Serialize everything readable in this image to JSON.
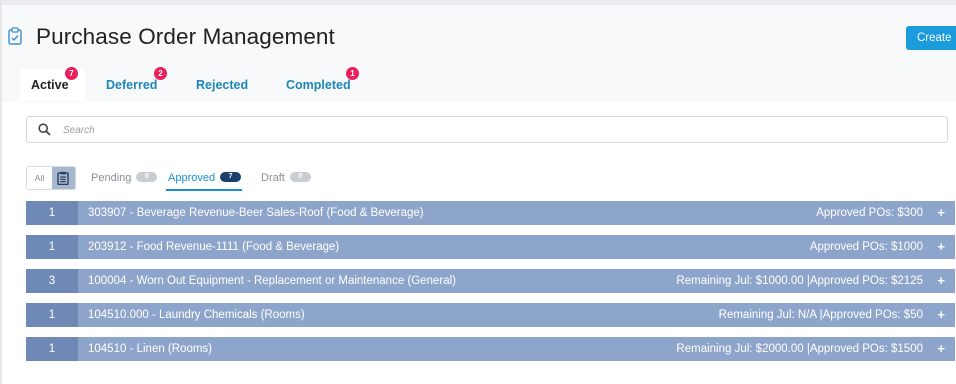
{
  "header": {
    "title": "Purchase Order Management",
    "title_icon": "clipboard-check-icon",
    "create_label": "Create"
  },
  "tabs": [
    {
      "label": "Active",
      "badge": "7",
      "active": true
    },
    {
      "label": "Deferred",
      "badge": "2",
      "active": false
    },
    {
      "label": "Rejected",
      "badge": "",
      "active": false
    },
    {
      "label": "Completed",
      "badge": "1",
      "active": false
    }
  ],
  "search": {
    "placeholder": "Search",
    "value": "",
    "icon": "search-icon"
  },
  "view_toggle": {
    "all_label": "All",
    "list_icon": "clipboard-list-icon"
  },
  "status_tabs": [
    {
      "label": "Pending",
      "count": "0",
      "active": false
    },
    {
      "label": "Approved",
      "count": "7",
      "active": true
    },
    {
      "label": "Draft",
      "count": "0",
      "active": false
    }
  ],
  "rows": [
    {
      "count": "1",
      "name": "303907 - Beverage Revenue-Beer Sales-Roof (Food & Beverage)",
      "summary": "Approved POs: $300",
      "action": "+"
    },
    {
      "count": "1",
      "name": "203912 - Food Revenue-1111 (Food & Beverage)",
      "summary": "Approved POs: $1000",
      "action": "+"
    },
    {
      "count": "3",
      "name": "100004 - Worn Out Equipment - Replacement or Maintenance (General)",
      "summary": "Remaining Jul: $1000.00 |Approved POs: $2125",
      "action": "+"
    },
    {
      "count": "1",
      "name": "104510.000 - Laundry Chemicals (Rooms)",
      "summary": "Remaining Jul: N/A |Approved POs: $50",
      "action": "+"
    },
    {
      "count": "1",
      "name": "104510 - Linen (Rooms)",
      "summary": "Remaining Jul: $2000.00 |Approved POs: $1500",
      "action": "+"
    }
  ],
  "colors": {
    "accent": "#1a9bdb",
    "badge": "#ea1f5c",
    "row_bg": "#8ea5cb",
    "row_count_bg": "#6f89b7",
    "tab_link": "#1f87b8"
  }
}
